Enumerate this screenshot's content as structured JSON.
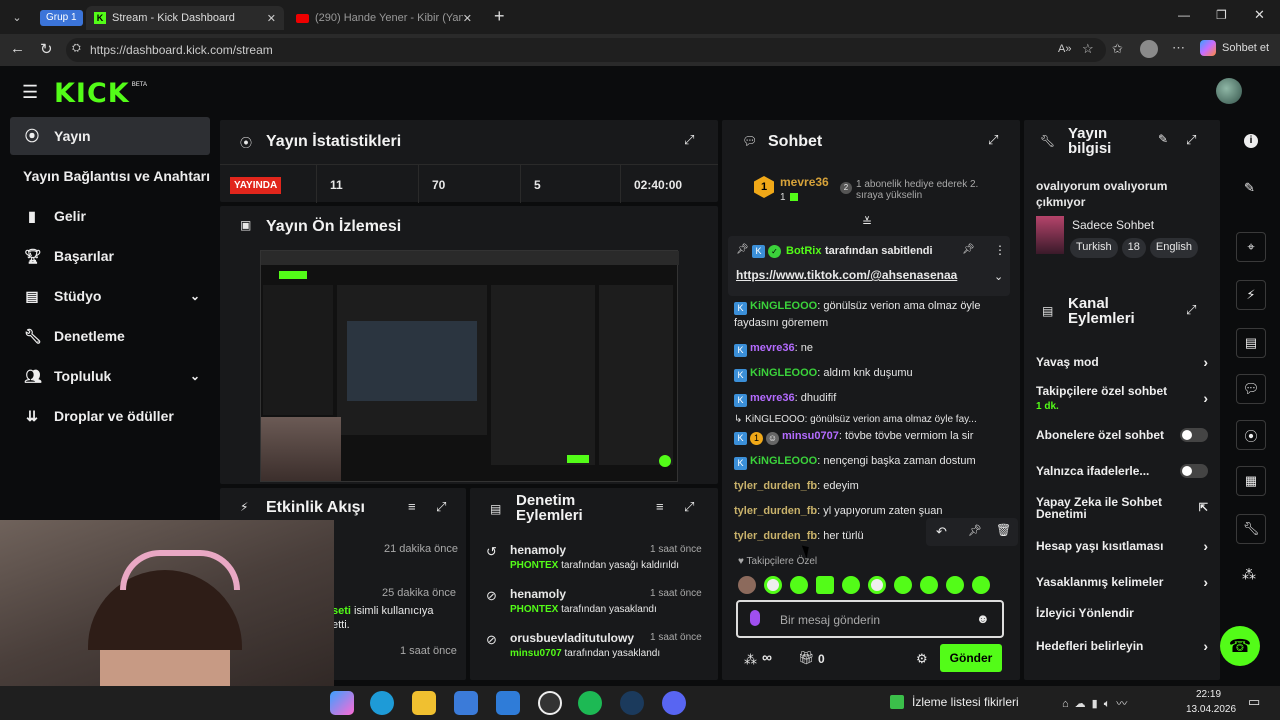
{
  "browser": {
    "tab_group": "Grup 1",
    "tabs": [
      {
        "title": "Stream - Kick Dashboard",
        "active": true
      },
      {
        "title": "(290) Hande Yener - Kibir (Yanman",
        "active": false
      }
    ],
    "url": "https://dashboard.kick.com/stream",
    "copilot_label": "Sohbet et"
  },
  "app": {
    "logo": "KICK",
    "logo_beta": "BETA",
    "nav": [
      {
        "label": "Yayın",
        "icon": "stream-icon",
        "active": true
      },
      {
        "label": "Yayın Bağlantısı ve Anahtarı",
        "icon": "",
        "active": false
      },
      {
        "label": "Gelir",
        "icon": "revenue-icon",
        "active": false
      },
      {
        "label": "Başarılar",
        "icon": "trophy-icon",
        "active": false
      },
      {
        "label": "Stüdyo",
        "icon": "studio-icon",
        "active": false,
        "chevron": true
      },
      {
        "label": "Denetleme",
        "icon": "wrench-icon",
        "active": false
      },
      {
        "label": "Topluluk",
        "icon": "community-icon",
        "active": false,
        "chevron": true
      },
      {
        "label": "Droplar ve ödüller",
        "icon": "drops-icon",
        "active": false
      }
    ],
    "stats": {
      "title": "Yayın İstatistikleri",
      "live_badge": "YAYINDA",
      "v1": "11",
      "v2": "70",
      "v3": "5",
      "time": "02:40:00"
    },
    "preview": {
      "title": "Yayın Ön İzlemesi"
    },
    "activity": {
      "title": "Etkinlik Akışı",
      "items": [
        {
          "time": "21 dakika önce"
        },
        {
          "time": "25 dakika önce",
          "user": "seti",
          "text": "isimli kullanıcıya",
          "text2": "etti."
        },
        {
          "time": "1 saat önce"
        }
      ]
    },
    "moderation": {
      "title": "Denetim Eylemleri",
      "items": [
        {
          "user": "henamoly",
          "time": "1 saat önce",
          "actor": "PHONTEX",
          "text": "tarafından yasağı kaldırıldı"
        },
        {
          "user": "henamoly",
          "time": "1 saat önce",
          "actor": "PHONTEX",
          "text": "tarafından yasaklandı"
        },
        {
          "user": "orusbuevladitutulowy",
          "time": "1 saat önce",
          "actor": "minsu0707",
          "text": "tarafından yasaklandı"
        }
      ]
    },
    "chat": {
      "title": "Sohbet",
      "top_user": "mevre36",
      "top_count": "1",
      "top_rank": "1",
      "gift_text": "1 abonelik hediye ederek 2. sıraya yükselin",
      "gift_count": "2",
      "pinned_by": "BotRix",
      "pinned_suffix": "tarafından sabitlendi",
      "pinned_link": "https://www.tiktok.com/@ahsenasenaa",
      "messages": [
        {
          "user": "KiNGLEOOO",
          "color": "#3bd23b",
          "text": "gönülsüz verion ama olmaz öyle faydasını göremem",
          "badge": true
        },
        {
          "user": "mevre36",
          "color": "#b46bff",
          "text": "ne",
          "badge": true
        },
        {
          "user": "KiNGLEOOO",
          "color": "#3bd23b",
          "text": "aldım knk duşumu",
          "badge": true
        },
        {
          "user": "mevre36",
          "color": "#b46bff",
          "text": "dhudifif",
          "badge": true
        },
        {
          "reply": "↳ KiNGLEOOO: gönülsüz verion ama olmaz öyle fay..."
        },
        {
          "user": "minsu0707",
          "color": "#b46bff",
          "text": "tövbe tövbe vermiom la sir",
          "badge": true
        },
        {
          "user": "KiNGLEOOO",
          "color": "#3bd23b",
          "text": "nençengi başka zaman dostum",
          "badge": true
        },
        {
          "user": "tyler_durden_fb",
          "color": "#c9b26b",
          "text": "edeyim"
        },
        {
          "user": "tyler_durden_fb",
          "color": "#c9b26b",
          "text": "yl yapıyorum zaten şuan"
        },
        {
          "user": "tyler_durden_fb",
          "color": "#c9b26b",
          "text": "her türlü"
        }
      ],
      "followers_only": "Takipçilere Özel",
      "placeholder": "Bir mesaj gönderin",
      "infinity": "∞",
      "gift_zero": "0",
      "send_label": "Gönder"
    },
    "info": {
      "title": "Yayın bilgisi",
      "stream_title": "ovalıyorum ovalıyorum çıkmıyor",
      "category": "Sadece Sohbet",
      "tags": [
        "Turkish",
        "18",
        "English"
      ]
    },
    "channel": {
      "title": "Kanal Eylemleri",
      "actions": [
        {
          "label": "Yavaş mod",
          "type": "chevron"
        },
        {
          "label": "Takipçilere özel sohbet",
          "sub": "1 dk.",
          "type": "chevron"
        },
        {
          "label": "Abonelere özel sohbet",
          "type": "toggle"
        },
        {
          "label": "Yalnızca ifadelerle...",
          "type": "toggle"
        },
        {
          "label": "Yapay Zeka ile Sohbet Denetimi",
          "type": "external"
        },
        {
          "label": "Hesap yaşı kısıtlaması",
          "type": "chevron"
        },
        {
          "label": "Yasaklanmış kelimeler",
          "type": "chevron"
        },
        {
          "label": "İzleyici Yönlendir",
          "type": "none"
        },
        {
          "label": "Hedefleri belirleyin",
          "type": "chevron"
        }
      ]
    }
  },
  "taskbar": {
    "watchlist": "İzleme listesi fikirleri",
    "time": "22:19",
    "date": "13.04.2026"
  },
  "colors": {
    "kick_green": "#53fc18",
    "panel": "#18191b",
    "live_red": "#e1261c"
  }
}
